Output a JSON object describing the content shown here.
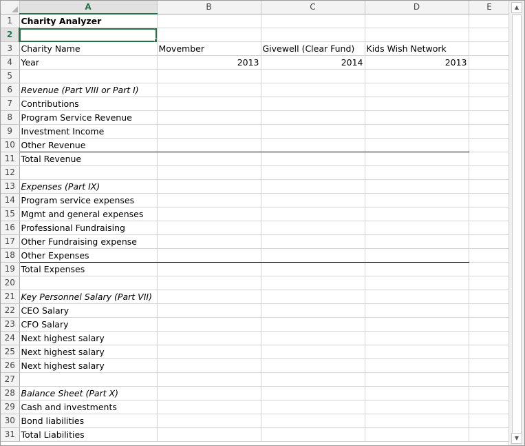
{
  "columns": [
    "A",
    "B",
    "C",
    "D",
    "E"
  ],
  "active_cell": "A2",
  "rows": [
    {
      "n": "1",
      "a": "Charity Analyzer",
      "style": "bold"
    },
    {
      "n": "2",
      "a": ""
    },
    {
      "n": "3",
      "a": "Charity Name",
      "b": "Movember",
      "c": "Givewell (Clear Fund)",
      "d": "Kids Wish Network"
    },
    {
      "n": "4",
      "a": "Year",
      "b": "2013",
      "c": "2014",
      "d": "2013"
    },
    {
      "n": "5",
      "a": ""
    },
    {
      "n": "6",
      "a": "Revenue (Part VIII or Part I)",
      "style": "italic"
    },
    {
      "n": "7",
      "a": "Contributions"
    },
    {
      "n": "8",
      "a": "Program Service Revenue"
    },
    {
      "n": "9",
      "a": "Investment Income"
    },
    {
      "n": "10",
      "a": "Other Revenue"
    },
    {
      "n": "11",
      "a": "Total Revenue"
    },
    {
      "n": "12",
      "a": ""
    },
    {
      "n": "13",
      "a": "Expenses (Part IX)",
      "style": "italic"
    },
    {
      "n": "14",
      "a": "Program service expenses"
    },
    {
      "n": "15",
      "a": "Mgmt and general expenses"
    },
    {
      "n": "16",
      "a": "Professional Fundraising"
    },
    {
      "n": "17",
      "a": "Other Fundraising expense"
    },
    {
      "n": "18",
      "a": "Other Expenses"
    },
    {
      "n": "19",
      "a": "Total Expenses"
    },
    {
      "n": "20",
      "a": ""
    },
    {
      "n": "21",
      "a": "Key Personnel Salary (Part VII)",
      "style": "italic"
    },
    {
      "n": "22",
      "a": "CEO Salary"
    },
    {
      "n": "23",
      "a": "CFO Salary"
    },
    {
      "n": "24",
      "a": "Next highest salary"
    },
    {
      "n": "25",
      "a": "Next highest salary"
    },
    {
      "n": "26",
      "a": "Next highest salary"
    },
    {
      "n": "27",
      "a": ""
    },
    {
      "n": "28",
      "a": "Balance Sheet (Part X)",
      "style": "italic"
    },
    {
      "n": "29",
      "a": "Cash and investments"
    },
    {
      "n": "30",
      "a": "Bond liabilities"
    },
    {
      "n": "31",
      "a": "Total Liabilities"
    }
  ],
  "colors": {
    "selection": "#217346",
    "header_bg": "#f3f3f3",
    "gridline": "#d4d4d4"
  }
}
